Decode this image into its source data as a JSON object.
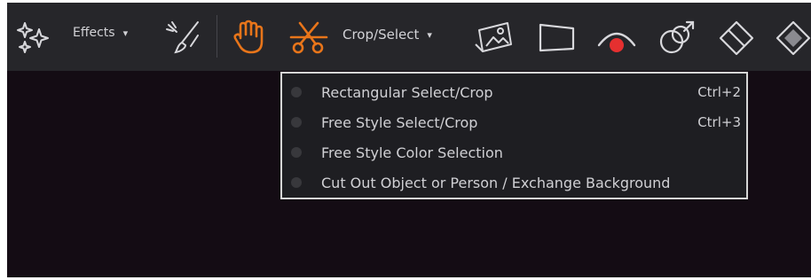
{
  "toolbar": {
    "effects_label": "Effects",
    "crop_select_label": "Crop/Select",
    "dropdown_caret": "▾",
    "colors": {
      "accent": "#e8751a",
      "record": "#e53030",
      "icon": "#d8d8dc",
      "background": "#26262a"
    }
  },
  "crop_menu": {
    "items": [
      {
        "label": "Rectangular Select/Crop",
        "shortcut": "Ctrl+2"
      },
      {
        "label": "Free Style Select/Crop",
        "shortcut": "Ctrl+3"
      },
      {
        "label": "Free Style Color Selection",
        "shortcut": ""
      },
      {
        "label": "Cut Out Object or Person / Exchange Background",
        "shortcut": ""
      }
    ]
  },
  "icons": [
    "sparkles-icon",
    "brush-icon",
    "hand-icon",
    "scissors-icon",
    "photo-icon",
    "perspective-icon",
    "red-eye-icon",
    "clone-stamp-icon",
    "eraser-icon",
    "fill-icon"
  ]
}
